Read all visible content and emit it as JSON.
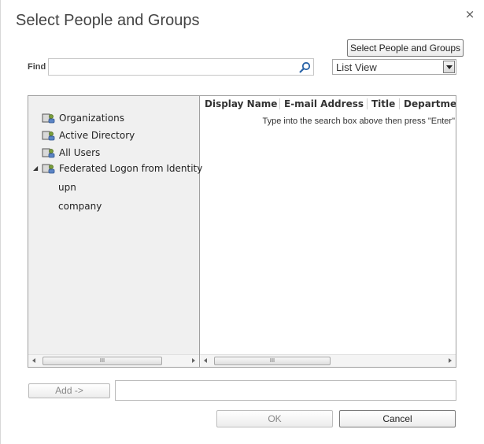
{
  "dialog": {
    "title": "Select People and Groups",
    "close_glyph": "×"
  },
  "toolbar": {
    "select_people_label": "Select People and Groups"
  },
  "find": {
    "label": "Find",
    "value": "",
    "placeholder": ""
  },
  "view": {
    "selected": "List View"
  },
  "tree": {
    "items": [
      {
        "label": "Organizations",
        "icon": "group-icon",
        "expanded": false
      },
      {
        "label": "Active Directory",
        "icon": "group-icon",
        "expanded": false
      },
      {
        "label": "All Users",
        "icon": "group-icon",
        "expanded": false
      },
      {
        "label": "Federated Logon from Identity",
        "icon": "group-icon",
        "expanded": true
      }
    ],
    "children": [
      "upn",
      "company"
    ],
    "expander_glyph": "◢"
  },
  "results": {
    "columns": [
      "Display Name",
      "E-mail Address",
      "Title",
      "Department"
    ],
    "hint": "Type into the search box above then press \"Enter\""
  },
  "scroll": {
    "grip": "III"
  },
  "footer": {
    "add_label": "Add ->",
    "ok_label": "OK",
    "cancel_label": "Cancel"
  },
  "colors": {
    "tree_bg": "#f0f0f0",
    "border": "#a0a0a0"
  }
}
